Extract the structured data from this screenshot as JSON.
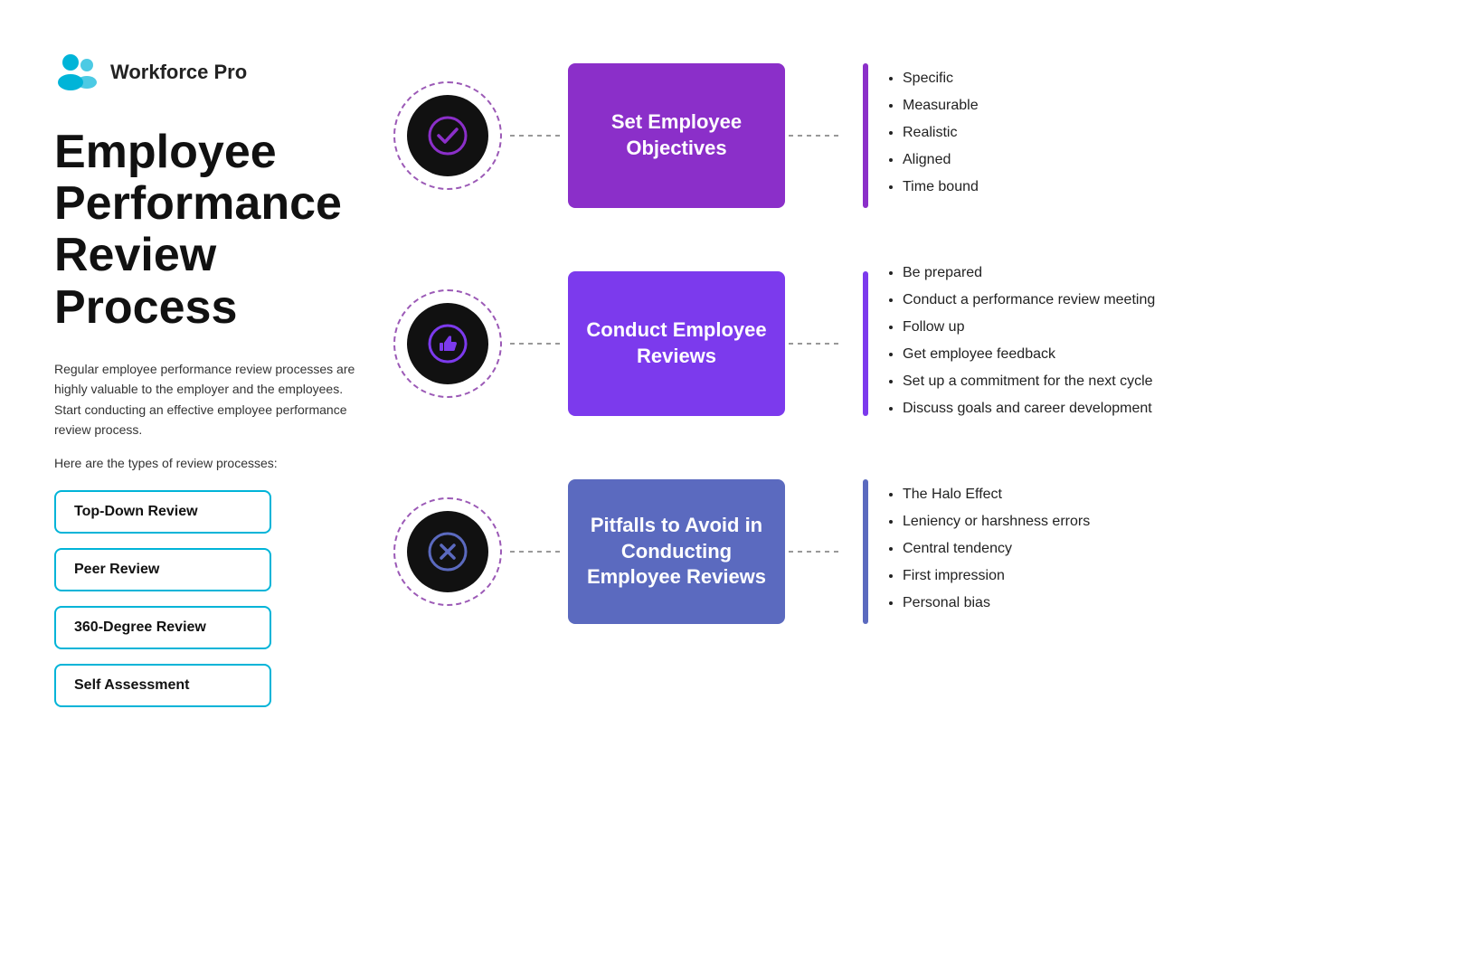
{
  "logo": {
    "text": "Workforce Pro"
  },
  "leftPanel": {
    "title": "Employee Performance Review Process",
    "description": "Regular employee performance review processes are highly valuable to the employer and the employees. Start conducting an effective employee performance review process.",
    "typesLabel": "Here are the types of review processes:",
    "buttons": [
      {
        "label": "Top-Down Review"
      },
      {
        "label": "Peer Review"
      },
      {
        "label": "360-Degree Review"
      },
      {
        "label": "Self Assessment"
      }
    ]
  },
  "processes": [
    {
      "id": "set-objectives",
      "iconType": "checkmark",
      "boxLabel": "Set Employee\nObjectives",
      "boxColor": "box-purple",
      "barColor": "bar-purple",
      "bullets": [
        "Specific",
        "Measurable",
        "Realistic",
        "Aligned",
        "Time bound"
      ]
    },
    {
      "id": "conduct-reviews",
      "iconType": "thumbsup",
      "boxLabel": "Conduct Employee\nReviews",
      "boxColor": "box-violet",
      "barColor": "bar-violet",
      "bullets": [
        "Be prepared",
        "Conduct a performance review meeting",
        "Follow up",
        "Get employee feedback",
        "Set up a commitment for the next cycle",
        "Discuss goals and career development"
      ]
    },
    {
      "id": "pitfalls",
      "iconType": "xmark",
      "boxLabel": "Pitfalls to Avoid\nin Conducting\nEmployee Reviews",
      "boxColor": "box-indigo",
      "barColor": "bar-indigo",
      "bullets": [
        "The Halo Effect",
        "Leniency or harshness errors",
        "Central tendency",
        "First impression",
        "Personal bias"
      ]
    }
  ]
}
